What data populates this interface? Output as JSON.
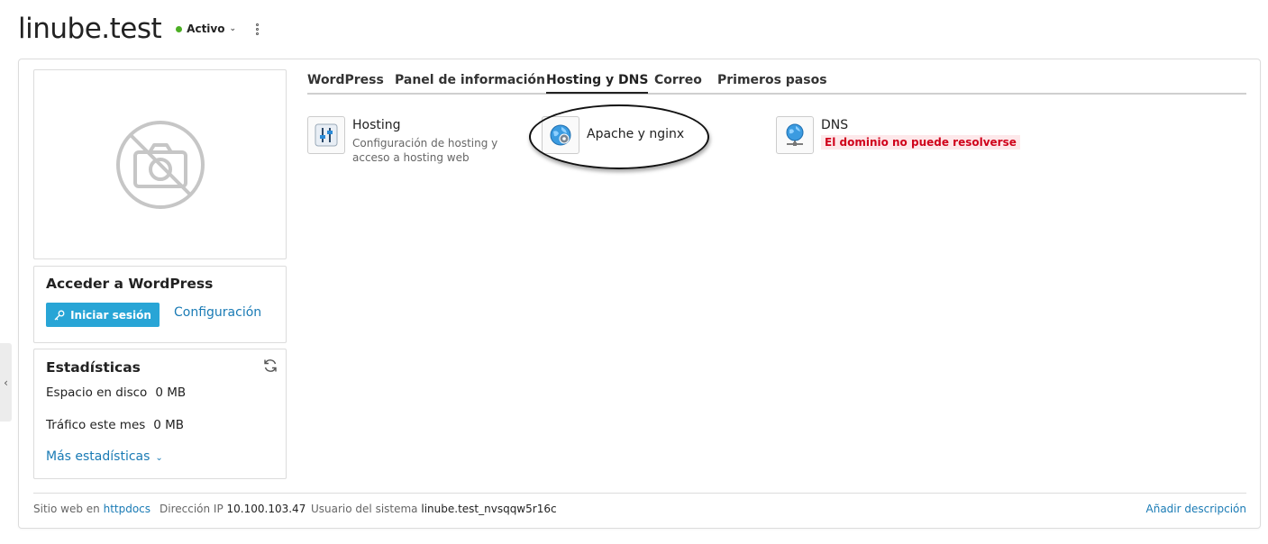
{
  "header": {
    "domain": "linube.test",
    "status_label": "Activo",
    "status_color": "#4caf24"
  },
  "wordpress": {
    "title": "Acceder a WordPress",
    "login_label": "Iniciar sesión",
    "config_label": "Configuración"
  },
  "stats": {
    "title": "Estadísticas",
    "disk_label": "Espacio en disco",
    "disk_value": "0 MB",
    "traffic_label": "Tráfico este mes",
    "traffic_value": "0 MB",
    "more_label": "Más estadísticas"
  },
  "tabs": [
    {
      "label": "WordPress",
      "active": false
    },
    {
      "label": "Panel de información",
      "active": false
    },
    {
      "label": "Hosting y DNS",
      "active": true
    },
    {
      "label": "Correo",
      "active": false
    },
    {
      "label": "Primeros pasos",
      "active": false
    }
  ],
  "services": {
    "hosting": {
      "name": "Hosting",
      "desc": "Configuración de hosting y acceso a hosting web",
      "icon": "sliders-icon"
    },
    "apache": {
      "name": "Apache y nginx",
      "icon": "globe-gear-icon"
    },
    "dns": {
      "name": "DNS",
      "warning": "El dominio no puede resolverse",
      "icon": "globe-network-icon"
    }
  },
  "footer": {
    "site_prefix": "Sitio web en",
    "site_link": "httpdocs",
    "ip_label": "Dirección IP",
    "ip_value": "10.100.103.47",
    "user_label": "Usuario del sistema",
    "user_value": "linube.test_nvsqqw5r16c",
    "add_desc": "Añadir descripción"
  },
  "colors": {
    "accent": "#28a5d6",
    "link": "#1a7bb5",
    "warning": "#d0021b"
  }
}
